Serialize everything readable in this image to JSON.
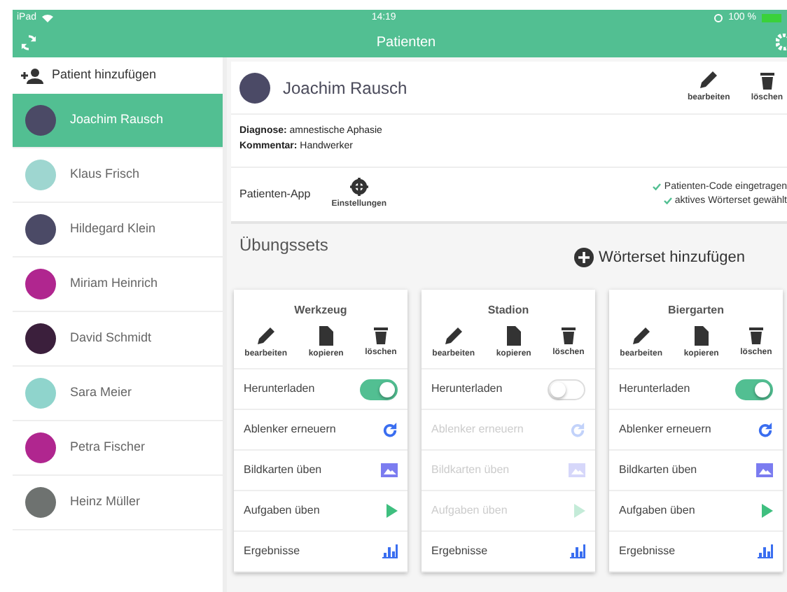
{
  "status_bar": {
    "device": "iPad",
    "time": "14:19",
    "battery": "100 %"
  },
  "navbar": {
    "title": "Patienten"
  },
  "sidebar": {
    "add_label": "Patient hinzufügen",
    "items": [
      {
        "name": "Joachim Rausch",
        "selected": true,
        "color": "#4b4a66"
      },
      {
        "name": "Klaus Frisch",
        "selected": false,
        "color": "#9ed6d0"
      },
      {
        "name": "Hildegard Klein",
        "selected": false,
        "color": "#4b4a66"
      },
      {
        "name": "Miriam Heinrich",
        "selected": false,
        "color": "#b0268f"
      },
      {
        "name": "David Schmidt",
        "selected": false,
        "color": "#3b1f3c"
      },
      {
        "name": "Sara Meier",
        "selected": false,
        "color": "#8fd4cc"
      },
      {
        "name": "Petra Fischer",
        "selected": false,
        "color": "#b0268f"
      },
      {
        "name": "Heinz Müller",
        "selected": false,
        "color": "#6e7270"
      }
    ]
  },
  "patient": {
    "name": "Joachim Rausch",
    "actions": [
      {
        "kind": "edit",
        "label": "bearbeiten"
      },
      {
        "kind": "delete",
        "label": "löschen"
      }
    ],
    "details": [
      {
        "label": "Diagnose:",
        "value": "amnestische Aphasie"
      },
      {
        "label": "Kommentar:",
        "value": "Handwerker"
      }
    ],
    "app": {
      "label": "Patienten-App",
      "settings": "Einstellungen",
      "checks": [
        "Patienten-Code eingetragen",
        "aktives Wörterset gewählt"
      ]
    }
  },
  "exercise_sets": {
    "title": "Übungssets",
    "add_button": "Wörterset hinzufügen",
    "sets": [
      {
        "name": "Werkzeug",
        "actions": [
          {
            "kind": "edit",
            "label": "bearbeiten"
          },
          {
            "kind": "copy",
            "label": "kopieren"
          },
          {
            "kind": "delete",
            "label": "löschen"
          }
        ],
        "rows": [
          {
            "kind": "toggle",
            "label": "Herunterladen",
            "on": true
          },
          {
            "kind": "refresh",
            "label": "Ablenker erneuern",
            "disabled": false
          },
          {
            "kind": "images",
            "label": "Bildkarten üben",
            "disabled": false
          },
          {
            "kind": "play",
            "label": "Aufgaben üben",
            "disabled": false
          },
          {
            "kind": "results",
            "label": "Ergebnisse",
            "disabled": false
          }
        ]
      },
      {
        "name": "Stadion",
        "actions": [
          {
            "kind": "edit",
            "label": "bearbeiten"
          },
          {
            "kind": "copy",
            "label": "kopieren"
          },
          {
            "kind": "delete",
            "label": "löschen"
          }
        ],
        "rows": [
          {
            "kind": "toggle",
            "label": "Herunterladen",
            "on": false
          },
          {
            "kind": "refresh",
            "label": "Ablenker erneuern",
            "disabled": true
          },
          {
            "kind": "images",
            "label": "Bildkarten üben",
            "disabled": true
          },
          {
            "kind": "play",
            "label": "Aufgaben üben",
            "disabled": true
          },
          {
            "kind": "results",
            "label": "Ergebnisse",
            "disabled": false
          }
        ]
      },
      {
        "name": "Biergarten",
        "actions": [
          {
            "kind": "edit",
            "label": "bearbeiten"
          },
          {
            "kind": "copy",
            "label": "kopieren"
          },
          {
            "kind": "delete",
            "label": "löschen"
          }
        ],
        "rows": [
          {
            "kind": "toggle",
            "label": "Herunterladen",
            "on": true
          },
          {
            "kind": "refresh",
            "label": "Ablenker erneuern",
            "disabled": false
          },
          {
            "kind": "images",
            "label": "Bildkarten üben",
            "disabled": false
          },
          {
            "kind": "play",
            "label": "Aufgaben üben",
            "disabled": false
          },
          {
            "kind": "results",
            "label": "Ergebnisse",
            "disabled": false
          }
        ]
      }
    ]
  }
}
